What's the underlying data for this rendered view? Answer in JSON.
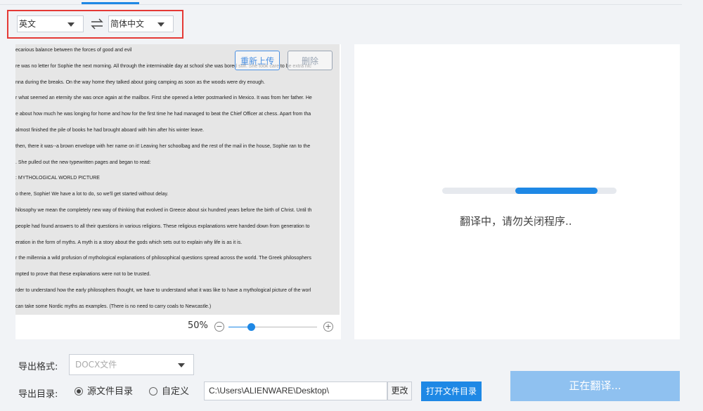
{
  "language": {
    "source": "英文",
    "target": "简体中文"
  },
  "preview": {
    "reupload_label": "重新上传",
    "delete_label": "删除",
    "zoom_label": "50%",
    "zoom_level": 0.25,
    "lines": [
      "ecarious balance between the forces of good and evil",
      "re was no letter for Sophie the next morning. All through the interminable day at school she was bored stiff. She took care to be extra nic",
      "nna during the breaks. On the way home they talked about going camping as soon as the woods were dry enough.",
      "r what seemed an eternity she was once again at the mailbox. First she opened a letter postmarked in Mexico. It was from her father. He",
      "e about how much he was longing for home and how for the first time he had managed to beat the Chief Officer at chess. Apart from tha",
      "almost finished the pile of books he had brought aboard with him after his winter leave.",
      "then, there it was--a brown envelope with her name on it! Leaving her schoolbag and the rest of the mail in the house, Sophie ran to the",
      ". She pulled out the new typewritten pages and began to read:",
      ": MYTHOLOGICAL WORLD PICTURE",
      "o there, Sophie! We have a lot to do, so we'll get started without delay.",
      "hilosophy we mean the completely new way of thinking that evolved in Greece about six hundred years before the birth of Christ. Until th",
      "people had found answers to all their questions in various religions. These religious explanations were handed down from generation to",
      "eration in the form of myths. A myth is a story about the gods which sets out to explain why life is as it is.",
      "r the millennia a wild profusion of mythological explanations of philosophical questions spread across the world. The Greek philosophers",
      "mpted to prove that these explanations were not to be trusted.",
      "rder to understand how the early philosophers thought, we have to understand what it was like to have a mythological picture of the worl",
      "can take some Nordic myths as examples. (There is no need to carry coals to Newcastle.)"
    ]
  },
  "result": {
    "progress_text": "翻译中，请勿关闭程序..",
    "progress_start": 0.42,
    "progress_end": 0.89
  },
  "export": {
    "format_label": "导出格式:",
    "format_value": "DOCX文件",
    "dir_label": "导出目录:",
    "radio_source": "源文件目录",
    "radio_custom": "自定义",
    "path_value": "C:\\Users\\ALIENWARE\\Desktop\\",
    "change_label": "更改",
    "open_dir_label": "打开文件目录",
    "translate_label": "正在翻译..."
  },
  "colors": {
    "accent": "#1e88e5",
    "highlight_box": "#e53935",
    "disabled_button": "#8fc1f0"
  }
}
